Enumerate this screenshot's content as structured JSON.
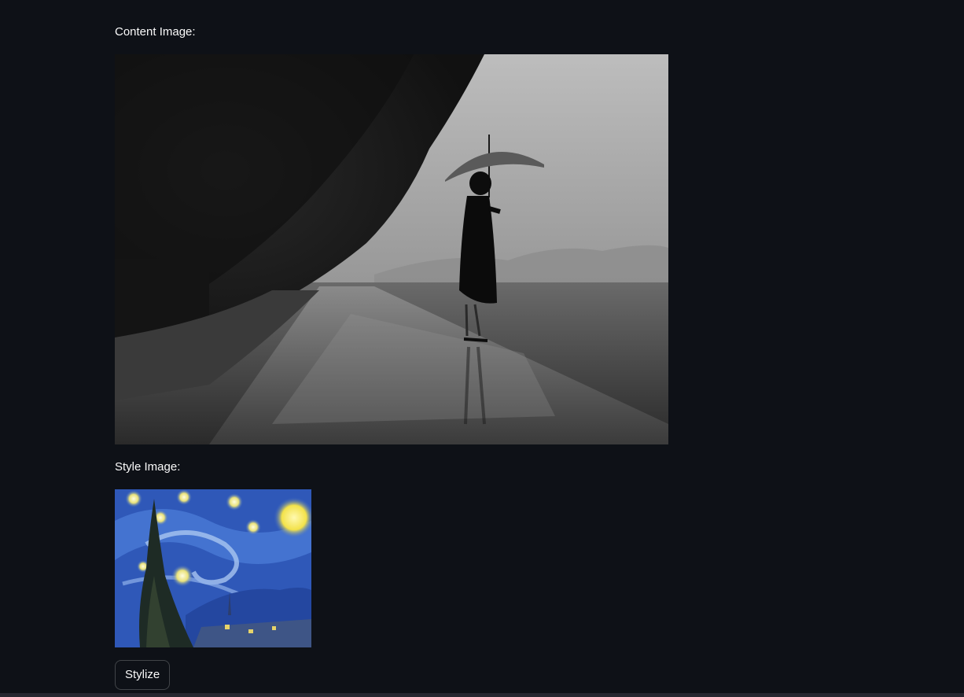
{
  "content_section": {
    "label": "Content Image:"
  },
  "style_section": {
    "label": "Style Image:"
  },
  "actions": {
    "stylize_label": "Stylize"
  },
  "colors": {
    "background": "#0e1117",
    "text": "#fafafa",
    "button_border": "#3a3c44"
  }
}
